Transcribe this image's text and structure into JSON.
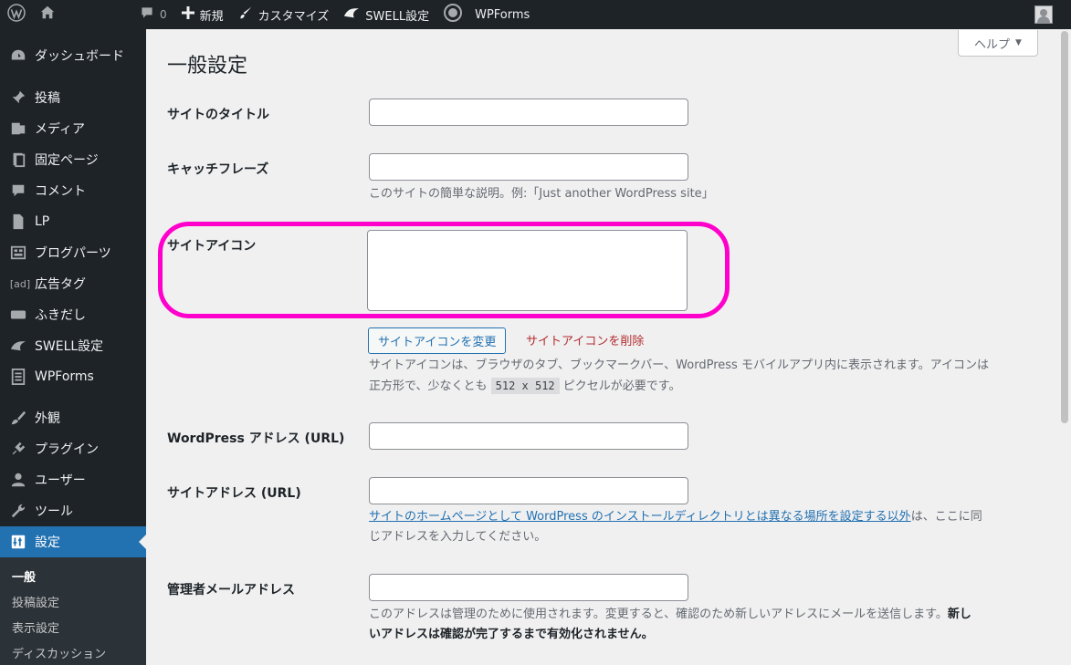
{
  "adminbar": {
    "site_name": "",
    "comments_count": "0",
    "new_label": "新規",
    "customize_label": "カスタマイズ",
    "swell_label": "SWELL設定",
    "wpforms_label": "WPForms"
  },
  "sidebar": {
    "items": [
      {
        "label": "ダッシュボード",
        "icon": "dashboard-icon"
      },
      {
        "label": "投稿",
        "icon": "pin-icon"
      },
      {
        "label": "メディア",
        "icon": "media-icon"
      },
      {
        "label": "固定ページ",
        "icon": "page-icon"
      },
      {
        "label": "コメント",
        "icon": "comment-icon"
      },
      {
        "label": "LP",
        "icon": "document-icon"
      },
      {
        "label": "ブログパーツ",
        "icon": "grid-icon"
      },
      {
        "label": "広告タグ",
        "icon": "ad-icon",
        "icon_text": "[ad]"
      },
      {
        "label": "ふきだし",
        "icon": "speech-bubble-icon"
      },
      {
        "label": "SWELL設定",
        "icon": "swell-icon"
      },
      {
        "label": "WPForms",
        "icon": "form-icon"
      },
      {
        "label": "外観",
        "icon": "brush-icon"
      },
      {
        "label": "プラグイン",
        "icon": "plugin-icon"
      },
      {
        "label": "ユーザー",
        "icon": "user-icon"
      },
      {
        "label": "ツール",
        "icon": "wrench-icon"
      },
      {
        "label": "設定",
        "icon": "settings-icon"
      }
    ],
    "submenu": [
      "一般",
      "投稿設定",
      "表示設定",
      "ディスカッション"
    ]
  },
  "page": {
    "help_label": "ヘルプ",
    "title": "一般設定"
  },
  "form": {
    "site_title_label": "サイトのタイトル",
    "site_title_value": "",
    "tagline_label": "キャッチフレーズ",
    "tagline_value": "",
    "tagline_desc": "このサイトの簡単な説明。例:「Just another WordPress site」",
    "site_icon_label": "サイトアイコン",
    "change_icon_button": "サイトアイコンを変更",
    "remove_icon_link": "サイトアイコンを削除",
    "icon_desc_1": "サイトアイコンは、ブラウザのタブ、ブックマークバー、WordPress モバイルアプリ内に表示されます。アイコンは",
    "icon_desc_2a": "正方形で、少なくとも",
    "icon_desc_code": "512 x 512",
    "icon_desc_2b": "ピクセルが必要です。",
    "wp_address_label": "WordPress アドレス (URL)",
    "wp_address_value": "",
    "site_address_label": "サイトアドレス (URL)",
    "site_address_value": "",
    "site_address_link": "サイトのホームページとして WordPress のインストールディレクトリとは異なる場所を設定する以外",
    "site_address_after": "は、ここに同",
    "site_address_line2": "じアドレスを入力してください。",
    "admin_email_label": "管理者メールアドレス",
    "admin_email_value": "",
    "admin_email_desc_1": "このアドレスは管理のために使用されます。変更すると、確認のため新しいアドレスにメールを送信します。",
    "admin_email_bold_1": "新し",
    "admin_email_bold_2": "いアドレスは確認が完了するまで有効化されません。"
  },
  "colors": {
    "admin_bg": "#1d2327",
    "accent": "#2271b1",
    "highlight": "#ff00cc",
    "delete": "#b32d2e"
  }
}
